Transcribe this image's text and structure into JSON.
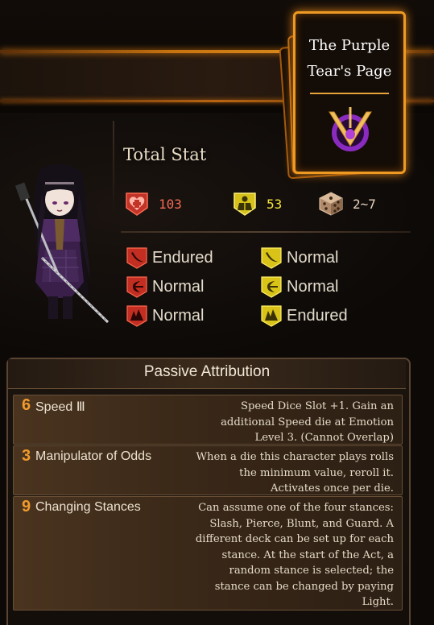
{
  "page_card": {
    "title_line1": "The Purple",
    "title_line2": "Tear's Page",
    "emblem_color": "#8a2bbf"
  },
  "total_stat": {
    "label": "Total Stat",
    "hp": {
      "icon": "heart-icon",
      "value": "103",
      "color": "#e0473a"
    },
    "stagger": {
      "icon": "stagger-icon",
      "value": "53",
      "color": "#e6d32a"
    },
    "speed": {
      "icon": "dice-icon",
      "value": "2~7",
      "color": "#d8b99a"
    }
  },
  "resistances": {
    "hp": [
      {
        "type": "slash",
        "icon": "slash-resist-icon",
        "label": "Endured"
      },
      {
        "type": "pierce",
        "icon": "pierce-resist-icon",
        "label": "Normal"
      },
      {
        "type": "blunt",
        "icon": "blunt-resist-icon",
        "label": "Normal"
      }
    ],
    "stagger": [
      {
        "type": "slash",
        "icon": "slash-resist-icon",
        "label": "Normal"
      },
      {
        "type": "pierce",
        "icon": "pierce-resist-icon",
        "label": "Normal"
      },
      {
        "type": "blunt",
        "icon": "blunt-resist-icon",
        "label": "Endured"
      }
    ]
  },
  "passives": {
    "title": "Passive Attribution",
    "items": [
      {
        "cost": "6",
        "name": "Speed Ⅲ",
        "desc": "Speed Dice Slot +1. Gain an additional Speed die at Emotion Level 3. (Cannot Overlap)"
      },
      {
        "cost": "3",
        "name": "Manipulator of Odds",
        "desc": "When a die this character plays rolls the minimum value, reroll it. Activates once per die."
      },
      {
        "cost": "9",
        "name": "Changing Stances",
        "desc": "Can assume one of the four stances: Slash, Pierce, Blunt, and Guard. A different deck can be set up for each stance. At the start of the Act, a random stance is selected; the stance can be changed by paying Light."
      }
    ]
  }
}
